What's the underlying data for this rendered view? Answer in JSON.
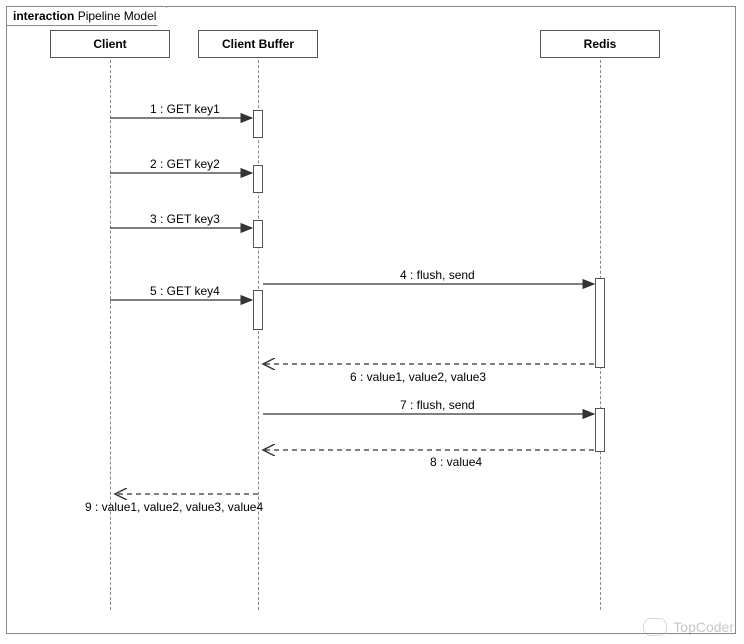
{
  "frame": {
    "keyword": "interaction",
    "title": "Pipeline Model"
  },
  "participants": {
    "client": "Client",
    "buffer": "Client Buffer",
    "redis": "Redis"
  },
  "messages": {
    "m1": "1 : GET key1",
    "m2": "2 : GET key2",
    "m3": "3 : GET key3",
    "m4": "4 : flush, send",
    "m5": "5 : GET key4",
    "m6": "6 : value1, value2, value3",
    "m7": "7 : flush, send",
    "m8": "8 : value4",
    "m9": "9 : value1, value2, value3, value4"
  },
  "watermark": "TopCoder"
}
